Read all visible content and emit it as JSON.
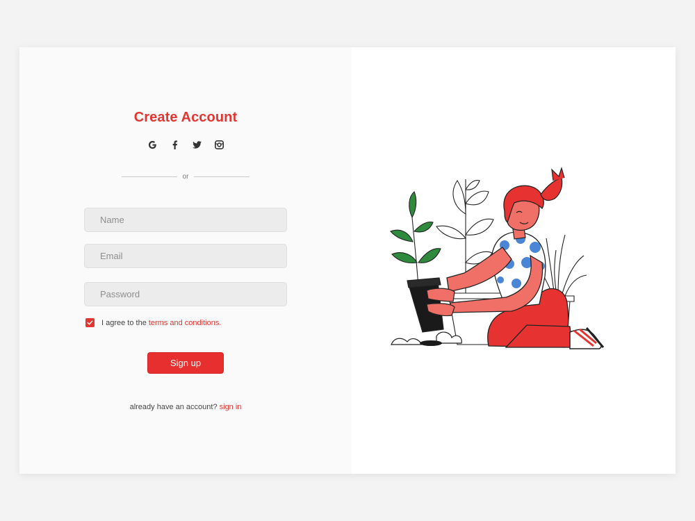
{
  "form": {
    "title": "Create Account",
    "socials": [
      {
        "name": "google",
        "icon": "google-icon"
      },
      {
        "name": "facebook",
        "icon": "facebook-icon"
      },
      {
        "name": "twitter",
        "icon": "twitter-icon"
      },
      {
        "name": "instagram",
        "icon": "instagram-icon"
      }
    ],
    "divider_text": "or",
    "name_placeholder": "Name",
    "email_placeholder": "Email",
    "password_placeholder": "Password",
    "agree_text": "I agree to the",
    "terms_link": "terms and conditions.",
    "agree_checked": true,
    "signup_label": "Sign up",
    "have_account_text": "already have an account?",
    "signin_link": "sign in"
  },
  "colors": {
    "accent": "#e23632",
    "button": "#e72f2f",
    "panel_left": "#fafafa",
    "panel_right": "#ffffff",
    "page_bg": "#f3f3f3",
    "leaf_green": "#2f8a3e",
    "dot_blue": "#4b86d6"
  },
  "illustration": {
    "icon": "woman-planting-illustration"
  }
}
